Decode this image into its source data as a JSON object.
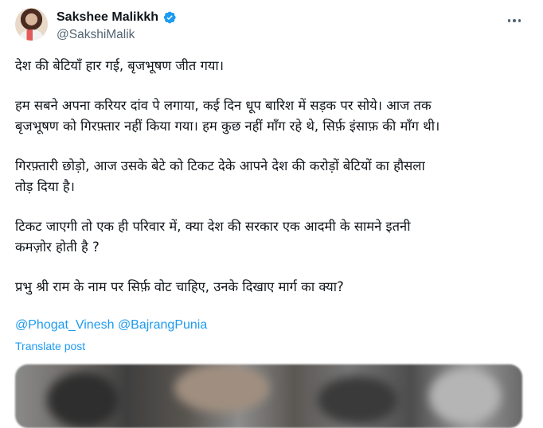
{
  "author": {
    "display_name": "Sakshee Malikkh",
    "handle": "@SakshiMalik",
    "verified": true
  },
  "icons": {
    "verified": "verified-badge-icon",
    "more": "more-options-icon"
  },
  "tweet": {
    "paragraphs": [
      [
        "देश की बेटियाँ हार गई, बृजभूषण जीत गया।"
      ],
      [
        "हम सबने अपना करियर दांव पे लगाया, कई दिन धूप बारिश में सड़क पर सोये। आज तक",
        "बृजभूषण को गिरफ़्तार नहीं किया गया। हम कुछ नहीं माँग रहे थे, सिर्फ़ इंसाफ़ की माँग थी।"
      ],
      [
        "गिरफ़्तारी छोड़ो, आज उसके बेटे को टिकट देके आपने देश की करोड़ों बेटियों का हौसला",
        "तोड़ दिया है।"
      ],
      [
        "टिकट जाएगी तो एक ही परिवार में, क्या देश की सरकार एक आदमी के सामने इतनी",
        "कमज़ोर होती है ?"
      ],
      [
        "प्रभु श्री राम के नाम पर सिर्फ़ वोट चाहिए, उनके दिखाए मार्ग का क्या?"
      ]
    ],
    "mentions": [
      "@Phogat_Vinesh",
      "@BajrangPunia"
    ],
    "translate_label": "Translate post"
  },
  "colors": {
    "link": "#1d9bf0",
    "secondary_text": "#536471",
    "verified": "#1d9bf0"
  }
}
